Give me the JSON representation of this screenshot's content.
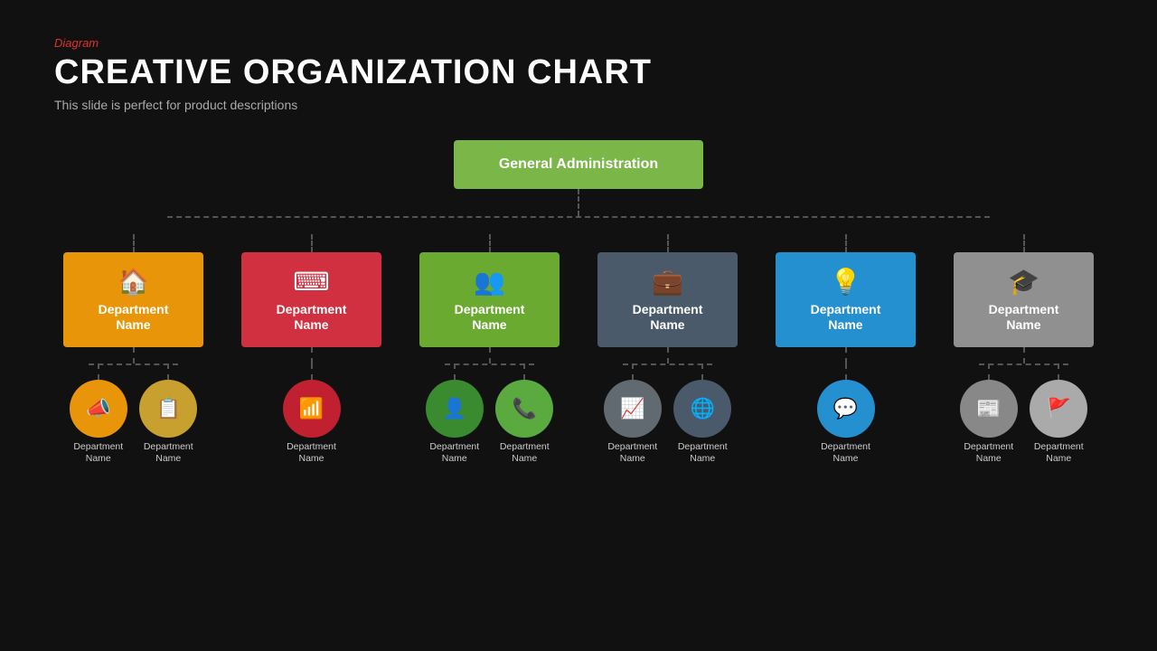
{
  "header": {
    "label": "Diagram",
    "title": "CREATIVE ORGANIZATION CHART",
    "subtitle": "This slide is perfect for product descriptions"
  },
  "top_node": {
    "label": "General Administration"
  },
  "departments": [
    {
      "id": "dept-1",
      "color": "orange",
      "icon": "🏠",
      "name": "Department\nName",
      "subs": [
        {
          "color": "orange",
          "icon": "📣",
          "label": "Department\nName"
        },
        {
          "color": "tan",
          "icon": "📋",
          "label": "Department\nName"
        }
      ]
    },
    {
      "id": "dept-2",
      "color": "red",
      "icon": "⌨",
      "name": "Department\nName",
      "subs": [
        {
          "color": "red",
          "icon": "📶",
          "label": "Department\nName"
        }
      ]
    },
    {
      "id": "dept-3",
      "color": "green",
      "icon": "👥",
      "name": "Department\nName",
      "subs": [
        {
          "color": "green-dark",
          "icon": "👤",
          "label": "Department\nName"
        },
        {
          "color": "green-mid",
          "icon": "📞",
          "label": "Department\nName"
        }
      ]
    },
    {
      "id": "dept-4",
      "color": "slate",
      "icon": "💼",
      "name": "Department\nName",
      "subs": [
        {
          "color": "slate2",
          "icon": "📈",
          "label": "Department\nName"
        },
        {
          "color": "slate",
          "icon": "🌐",
          "label": "Department\nName"
        }
      ]
    },
    {
      "id": "dept-5",
      "color": "blue",
      "icon": "💡",
      "name": "Department\nName",
      "subs": [
        {
          "color": "blue",
          "icon": "💬",
          "label": "Department\nName"
        }
      ]
    },
    {
      "id": "dept-6",
      "color": "gray",
      "icon": "🎓",
      "name": "Department\nName",
      "subs": [
        {
          "color": "gray",
          "icon": "📰",
          "label": "Department\nName"
        },
        {
          "color": "gray2",
          "icon": "🚩",
          "label": "Department\nName"
        }
      ]
    }
  ],
  "colors": {
    "orange": "#e8950a",
    "red": "#d03040",
    "green": "#6aaa30",
    "slate": "#4a5a6a",
    "blue": "#2590d0",
    "gray": "#909090",
    "top_node_bg": "#7ab648",
    "accent_red": "#e03030"
  }
}
